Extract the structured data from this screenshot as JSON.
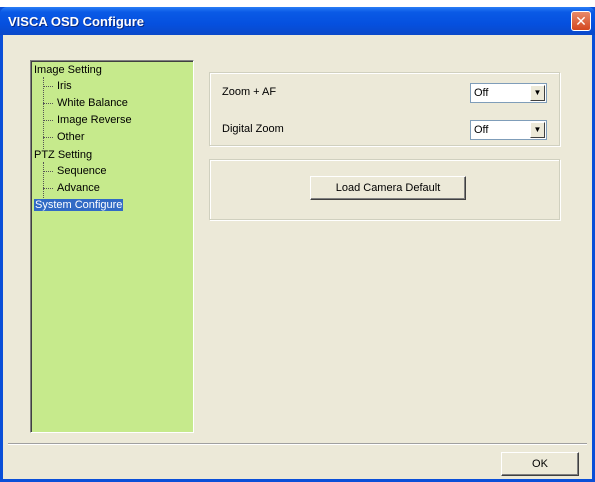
{
  "window": {
    "title": "VISCA OSD Configure",
    "close_glyph": "✕"
  },
  "tree": {
    "items": [
      {
        "label": "Image Setting",
        "level": 0
      },
      {
        "label": "Iris",
        "level": 1
      },
      {
        "label": "White Balance",
        "level": 1
      },
      {
        "label": "Image Reverse",
        "level": 1
      },
      {
        "label": "Other",
        "level": 1
      },
      {
        "label": "PTZ Setting",
        "level": 0
      },
      {
        "label": "Sequence",
        "level": 1
      },
      {
        "label": "Advance",
        "level": 1
      },
      {
        "label": "System Configure",
        "level": 0,
        "selected": true
      }
    ]
  },
  "settings": {
    "zoom_af": {
      "label": "Zoom + AF",
      "value": "Off"
    },
    "digital_zoom": {
      "label": "Digital Zoom",
      "value": "Off"
    },
    "load_default_label": "Load Camera Default"
  },
  "footer": {
    "ok_label": "OK"
  },
  "colors": {
    "tree_bg": "#c6ea8c",
    "title_bar": "#0550df",
    "selection": "#316ac5",
    "dialog_bg": "#ece9d8"
  },
  "icons": {
    "dropdown": "chevron-down-icon",
    "close": "close-icon"
  }
}
